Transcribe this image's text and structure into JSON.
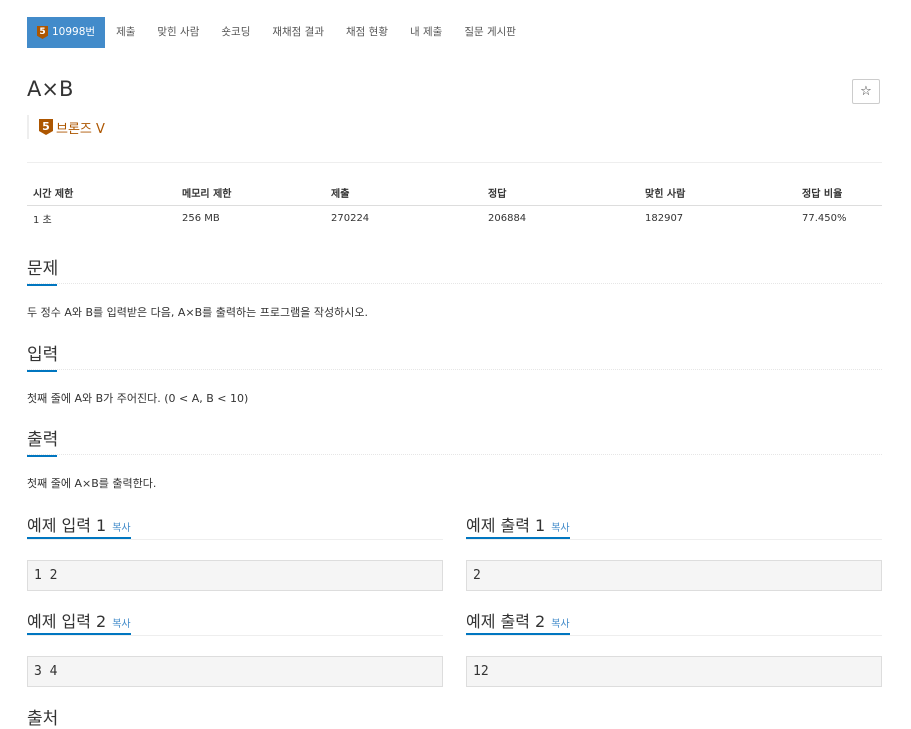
{
  "colors": {
    "accent": "#428bca",
    "bronze": "#ad5600",
    "underline": "#0076c0"
  },
  "nav": {
    "problem_tab": {
      "tier_icon": "bronze-5-badge",
      "tier_number": "5",
      "label": "10998번"
    },
    "items": [
      "제출",
      "맞힌 사람",
      "숏코딩",
      "재채점 결과",
      "채점 현황",
      "내 제출",
      "질문 게시판"
    ]
  },
  "problem": {
    "title": "A×B",
    "star_icon": "star-outline-icon",
    "star_glyph": "☆",
    "tier_number": "5",
    "tier_label": "브론즈 V"
  },
  "info_table": {
    "headers": [
      "시간 제한",
      "메모리 제한",
      "제출",
      "정답",
      "맞힌 사람",
      "정답 비율"
    ],
    "row": [
      "1 초",
      "256 MB",
      "270224",
      "206884",
      "182907",
      "77.450%"
    ]
  },
  "sections": {
    "description": {
      "title": "문제",
      "text": "두 정수 A와 B를 입력받은 다음, A×B를 출력하는 프로그램을 작성하시오."
    },
    "input": {
      "title": "입력",
      "text": "첫째 줄에 A와 B가 주어진다. (0 < A, B < 10)"
    },
    "output": {
      "title": "출력",
      "text": "첫째 줄에 A×B를 출력한다."
    },
    "source": {
      "title": "출처"
    }
  },
  "samples": {
    "copy_label": "복사",
    "input1": {
      "title": "예제 입력 1",
      "value": "1 2"
    },
    "output1": {
      "title": "예제 출력 1",
      "value": "2"
    },
    "input2": {
      "title": "예제 입력 2",
      "value": "3 4"
    },
    "output2": {
      "title": "예제 출력 2",
      "value": "12"
    }
  }
}
